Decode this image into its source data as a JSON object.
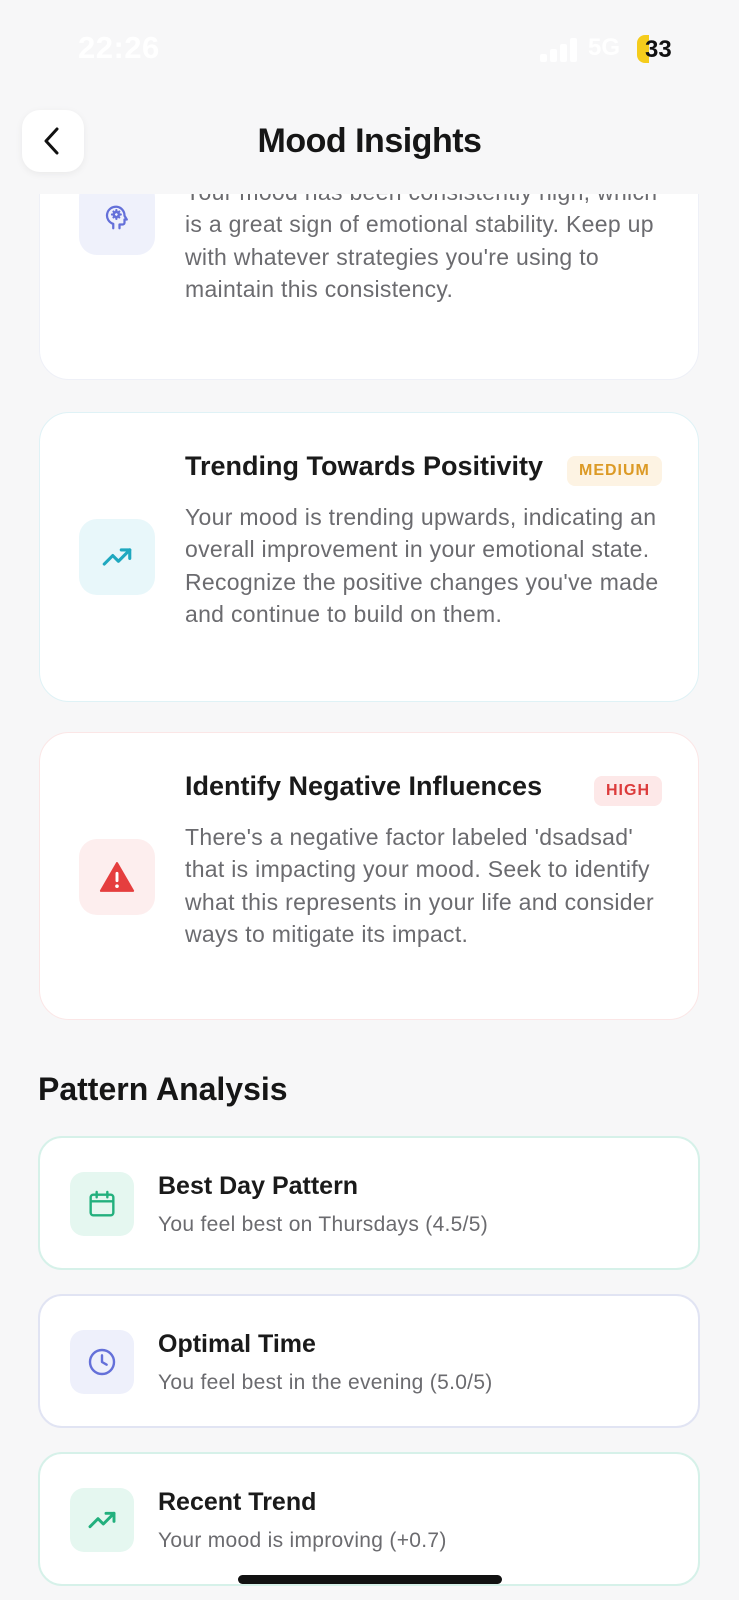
{
  "status_bar": {
    "time": "22:26",
    "network": "5G",
    "battery": "33"
  },
  "header": {
    "title": "Mood Insights"
  },
  "insights": [
    {
      "icon": "brain-gear-icon",
      "title": "",
      "badge": "",
      "description": "Your mood has been consistently high, which is a great sign of emotional stability. Keep up with whatever strategies you're using to maintain this consistency."
    },
    {
      "icon": "trending-up-icon",
      "title": "Trending Towards Positivity",
      "badge": "MEDIUM",
      "description": "Your mood is trending upwards, indicating an overall improvement in your emotional state. Recognize the positive changes you've made and continue to build on them."
    },
    {
      "icon": "warning-icon",
      "title": "Identify Negative Influences",
      "badge": "HIGH",
      "description": "There's a negative factor labeled 'dsadsad' that is impacting your mood. Seek to identify what this represents in your life and consider ways to mitigate its impact."
    }
  ],
  "pattern_analysis": {
    "title": "Pattern Analysis",
    "items": [
      {
        "icon": "calendar-icon",
        "title": "Best Day Pattern",
        "subtitle": "You feel best on Thursdays (4.5/5)"
      },
      {
        "icon": "clock-icon",
        "title": "Optimal Time",
        "subtitle": "You feel best in the evening (5.0/5)"
      },
      {
        "icon": "trending-up-icon",
        "title": "Recent Trend",
        "subtitle": "Your mood is improving (+0.7)"
      }
    ]
  },
  "colors": {
    "medium_badge": "#dc9a26",
    "high_badge": "#dc3b3b",
    "teal_accent": "#1fa8bf",
    "green_accent": "#22b07d",
    "indigo_accent": "#6470d9",
    "red_accent": "#e53e3e"
  }
}
